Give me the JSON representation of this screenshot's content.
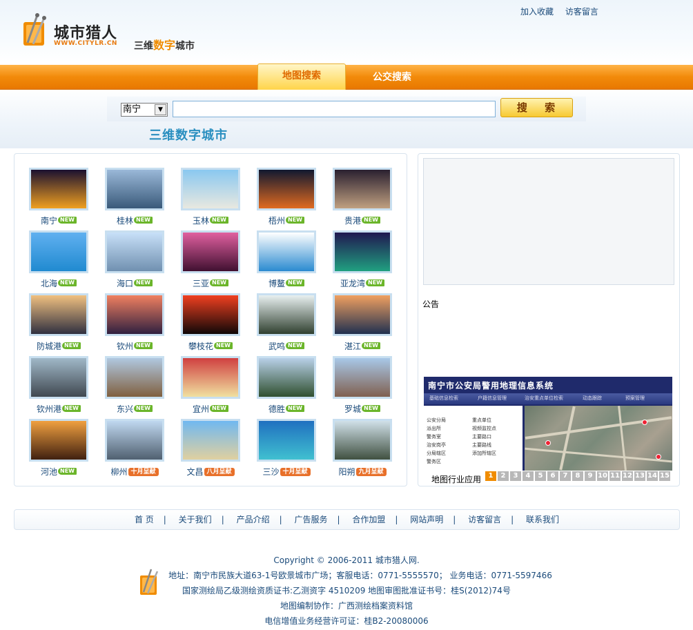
{
  "header": {
    "top_links": [
      "加入收藏",
      "访客留言"
    ],
    "logo_name": "城市猎人",
    "logo_url": "WWW.CITYLR.CN",
    "slogan_prefix": "三维",
    "slogan_highlight": "数字",
    "slogan_suffix": "城市"
  },
  "nav": {
    "tabs": [
      {
        "label": "地图搜索",
        "active": true
      },
      {
        "label": "公交搜索",
        "active": false
      }
    ]
  },
  "search": {
    "selected_city": "南宁",
    "query": "",
    "button_label": "搜 索",
    "subtitle": "三维数字城市"
  },
  "cities": [
    {
      "name": "南宁",
      "badge": "NEW",
      "palette": [
        "#1a1030",
        "#f0a020"
      ]
    },
    {
      "name": "桂林",
      "badge": "NEW",
      "palette": [
        "#9ab8d8",
        "#3a5a7a"
      ]
    },
    {
      "name": "玉林",
      "badge": "NEW",
      "palette": [
        "#8ac8f0",
        "#e8e8e0"
      ]
    },
    {
      "name": "梧州",
      "badge": "NEW",
      "palette": [
        "#101830",
        "#e06a20"
      ]
    },
    {
      "name": "贵港",
      "badge": "NEW",
      "palette": [
        "#2a2030",
        "#c0a080"
      ]
    },
    {
      "name": "北海",
      "badge": "NEW",
      "palette": [
        "#60b0f0",
        "#208ad0"
      ]
    },
    {
      "name": "海口",
      "badge": "NEW",
      "palette": [
        "#c8e0f8",
        "#7090b0"
      ]
    },
    {
      "name": "三亚",
      "badge": "NEW",
      "palette": [
        "#e060a0",
        "#401030"
      ]
    },
    {
      "name": "博鳌",
      "badge": "NEW",
      "palette": [
        "#ffffff",
        "#2a8ad0"
      ]
    },
    {
      "name": "亚龙湾",
      "badge": "NEW",
      "palette": [
        "#201850",
        "#20a080"
      ]
    },
    {
      "name": "防城港",
      "badge": "NEW",
      "palette": [
        "#f0c080",
        "#303040"
      ]
    },
    {
      "name": "钦州",
      "badge": "NEW",
      "palette": [
        "#f08060",
        "#302040"
      ]
    },
    {
      "name": "攀枝花",
      "badge": "NEW",
      "palette": [
        "#f04020",
        "#100808"
      ]
    },
    {
      "name": "武鸣",
      "badge": "NEW",
      "palette": [
        "#e8f0f0",
        "#304030"
      ]
    },
    {
      "name": "湛江",
      "badge": "NEW",
      "palette": [
        "#f0a060",
        "#203050"
      ]
    },
    {
      "name": "钦州港",
      "badge": "NEW",
      "palette": [
        "#a0b8c8",
        "#404850"
      ]
    },
    {
      "name": "东兴",
      "badge": "NEW",
      "palette": [
        "#b0c8e0",
        "#806040"
      ]
    },
    {
      "name": "宜州",
      "badge": "NEW",
      "palette": [
        "#d04040",
        "#f0e0a0"
      ]
    },
    {
      "name": "德胜",
      "badge": "NEW",
      "palette": [
        "#b8d0e8",
        "#305030"
      ]
    },
    {
      "name": "罗城",
      "badge": "NEW",
      "palette": [
        "#a8c8e8",
        "#806050"
      ]
    },
    {
      "name": "河池",
      "badge": "NEW",
      "palette": [
        "#f0a040",
        "#402010"
      ]
    },
    {
      "name": "柳州",
      "badge": "十月呈献",
      "palette": [
        "#c0d8f0",
        "#506070"
      ]
    },
    {
      "name": "文昌",
      "badge": "八月呈献",
      "palette": [
        "#70b8f0",
        "#e0d0a0"
      ]
    },
    {
      "name": "三沙",
      "badge": "十月呈献",
      "palette": [
        "#2070c0",
        "#40c0d0"
      ]
    },
    {
      "name": "阳朔",
      "badge": "九月呈献",
      "palette": [
        "#d0e0e8",
        "#405040"
      ]
    }
  ],
  "notice": {
    "title": "公告"
  },
  "gis": {
    "title": "南宁市公安局警用地理信息系统",
    "menu": [
      "基础信息检索",
      "户籍信息管理",
      "治安重点单位检索",
      "动态跟踪",
      "预案管理"
    ],
    "list_left": [
      "公安分局",
      "派出所",
      "警务室",
      "治安岗亭",
      "分局辖区",
      "警务区"
    ],
    "list_right": [
      "重点单位",
      "视频监控点",
      "主要路口",
      "主要路线",
      "添加所辖区"
    ]
  },
  "pager": {
    "label": "地图行业应用",
    "pages": [
      "1",
      "2",
      "3",
      "4",
      "5",
      "6",
      "7",
      "8",
      "9",
      "10",
      "11",
      "12",
      "13",
      "14",
      "15"
    ],
    "current": "1"
  },
  "footer": {
    "nav": [
      "首 页",
      "关于我们",
      "产品介绍",
      "广告服务",
      "合作加盟",
      "网站声明",
      "访客留言",
      "联系我们"
    ],
    "copyright": "Copyright © 2006-2011 城市猎人网.",
    "address": "地址：南宁市民族大道63-1号欧景城市广场；客服电话：0771-5555570； 业务电话：0771-5597466",
    "license": "国家测绘局乙级测绘资质证书:乙测资字 4510209   地图审图批准证书号：桂S(2012)74号",
    "cooperation": "地图编制协作：广西测绘档案资料馆",
    "icp": "电信增值业务经营许可证：桂B2-20080006"
  }
}
